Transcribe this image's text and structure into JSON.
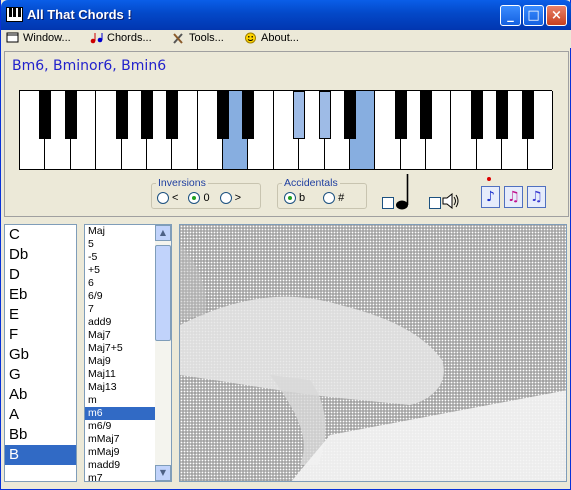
{
  "window": {
    "title": "All That Chords !"
  },
  "menu": [
    {
      "label": "Window...",
      "icon": "piano-icon"
    },
    {
      "label": "Chords...",
      "icon": "music-notes-icon"
    },
    {
      "label": "Tools...",
      "icon": "tools-icon"
    },
    {
      "label": "About...",
      "icon": "smiley-icon"
    }
  ],
  "chord_name": "Bm6, Bminor6, Bmin6",
  "piano": {
    "highlighted_keys": [
      "B",
      "D",
      "F#",
      "G#"
    ],
    "highlight_color": "#87aee0"
  },
  "inversions": {
    "legend": "Inversions",
    "options": [
      "<",
      "0",
      ">"
    ],
    "selected": "0"
  },
  "accidentals": {
    "legend": "Accidentals",
    "options": [
      "b",
      "#"
    ],
    "selected": "b"
  },
  "notes": [
    "C",
    "Db",
    "D",
    "Eb",
    "E",
    "F",
    "Gb",
    "G",
    "Ab",
    "A",
    "Bb",
    "B"
  ],
  "selected_note": "B",
  "chord_types": [
    "Maj",
    "5",
    "-5",
    "+5",
    "6",
    "6/9",
    "7",
    "add9",
    "Maj7",
    "Maj7+5",
    "Maj9",
    "Maj11",
    "Maj13",
    "m",
    "m6",
    "m6/9",
    "mMaj7",
    "mMaj9",
    "madd9",
    "m7"
  ],
  "selected_chord_type": "m6",
  "colors": {
    "titlebar": "#0348c8",
    "selection": "#316ac5",
    "chord_name": "#2222cc"
  }
}
